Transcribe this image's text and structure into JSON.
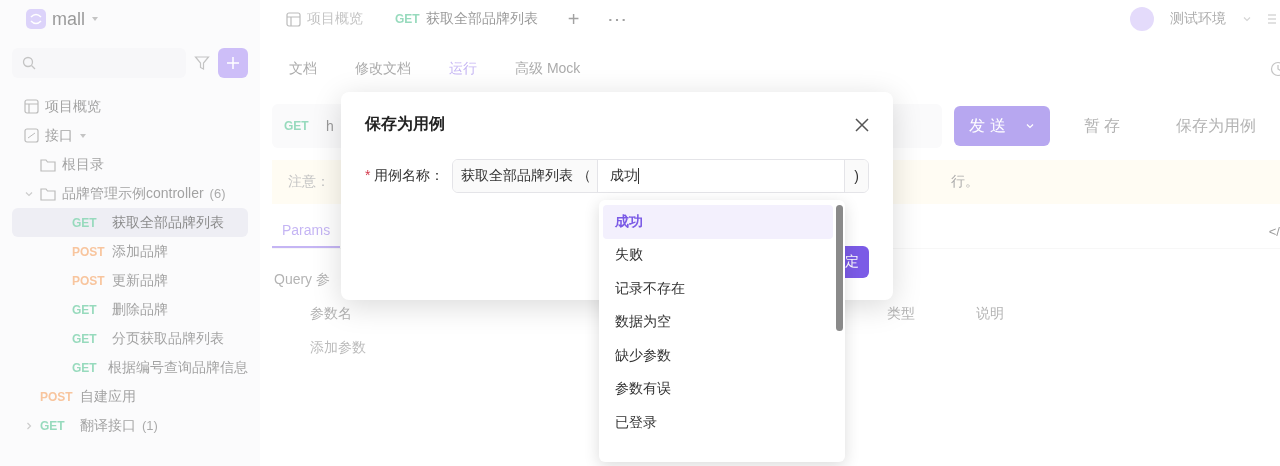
{
  "app": {
    "project": "mall"
  },
  "tabs": [
    {
      "kind": "overview",
      "label": "项目概览",
      "selected": false
    },
    {
      "kind": "api",
      "method": "GET",
      "label": "获取全部品牌列表",
      "selected": true
    }
  ],
  "tab_actions": {
    "add": "+",
    "more": "⋯"
  },
  "environment": {
    "name": "测试环境"
  },
  "sidebar": {
    "items": [
      {
        "kind": "overview",
        "label": "项目概览"
      },
      {
        "kind": "section",
        "label": "接口",
        "children": [
          {
            "kind": "folder",
            "label": "根目录"
          },
          {
            "kind": "folder",
            "label": "品牌管理示例controller",
            "count": "(6)",
            "expanded": true,
            "children": [
              {
                "kind": "api",
                "method": "GET",
                "label": "获取全部品牌列表",
                "selected": true
              },
              {
                "kind": "api",
                "method": "POST",
                "label": "添加品牌",
                "selected": false
              },
              {
                "kind": "api",
                "method": "POST",
                "label": "更新品牌",
                "selected": false
              },
              {
                "kind": "api",
                "method": "GET",
                "label": "删除品牌",
                "selected": false
              },
              {
                "kind": "api",
                "method": "GET",
                "label": "分页获取品牌列表",
                "selected": false
              },
              {
                "kind": "api",
                "method": "GET",
                "label": "根据编号查询品牌信息",
                "selected": false
              }
            ]
          },
          {
            "kind": "api",
            "method": "POST",
            "label": "自建应用",
            "selected": false
          },
          {
            "kind": "api",
            "method": "GET",
            "label": "翻译接口",
            "count": "(1)",
            "expanded": false,
            "selected": false
          }
        ]
      }
    ]
  },
  "subtabs": [
    {
      "label": "文档",
      "selected": false
    },
    {
      "label": "修改文档",
      "selected": false
    },
    {
      "label": "运行",
      "selected": true
    },
    {
      "label": "高级 Mock",
      "selected": false
    }
  ],
  "request": {
    "method": "GET",
    "url": "h",
    "send": "发 送",
    "stash": "暂 存",
    "save_case": "保存为用例"
  },
  "notice": {
    "start": "注意：",
    "end": "行。"
  },
  "params_tabs": [
    {
      "label": "Params",
      "selected": true
    }
  ],
  "code_toggle": "</",
  "query": {
    "title": "Query 参",
    "columns": [
      "参数名",
      "类型",
      "说明"
    ],
    "add": "添加参数"
  },
  "dialog": {
    "title": "保存为用例",
    "label": "用例名称：",
    "required_mark": "*",
    "prefix": "获取全部品牌列表 （",
    "value": "成功",
    "suffix": ")",
    "confirm": "定"
  },
  "dropdown": {
    "options": [
      {
        "label": "成功",
        "selected": true
      },
      {
        "label": "失败",
        "selected": false
      },
      {
        "label": "记录不存在",
        "selected": false
      },
      {
        "label": "数据为空",
        "selected": false
      },
      {
        "label": "缺少参数",
        "selected": false
      },
      {
        "label": "参数有误",
        "selected": false
      },
      {
        "label": "已登录",
        "selected": false
      }
    ]
  }
}
